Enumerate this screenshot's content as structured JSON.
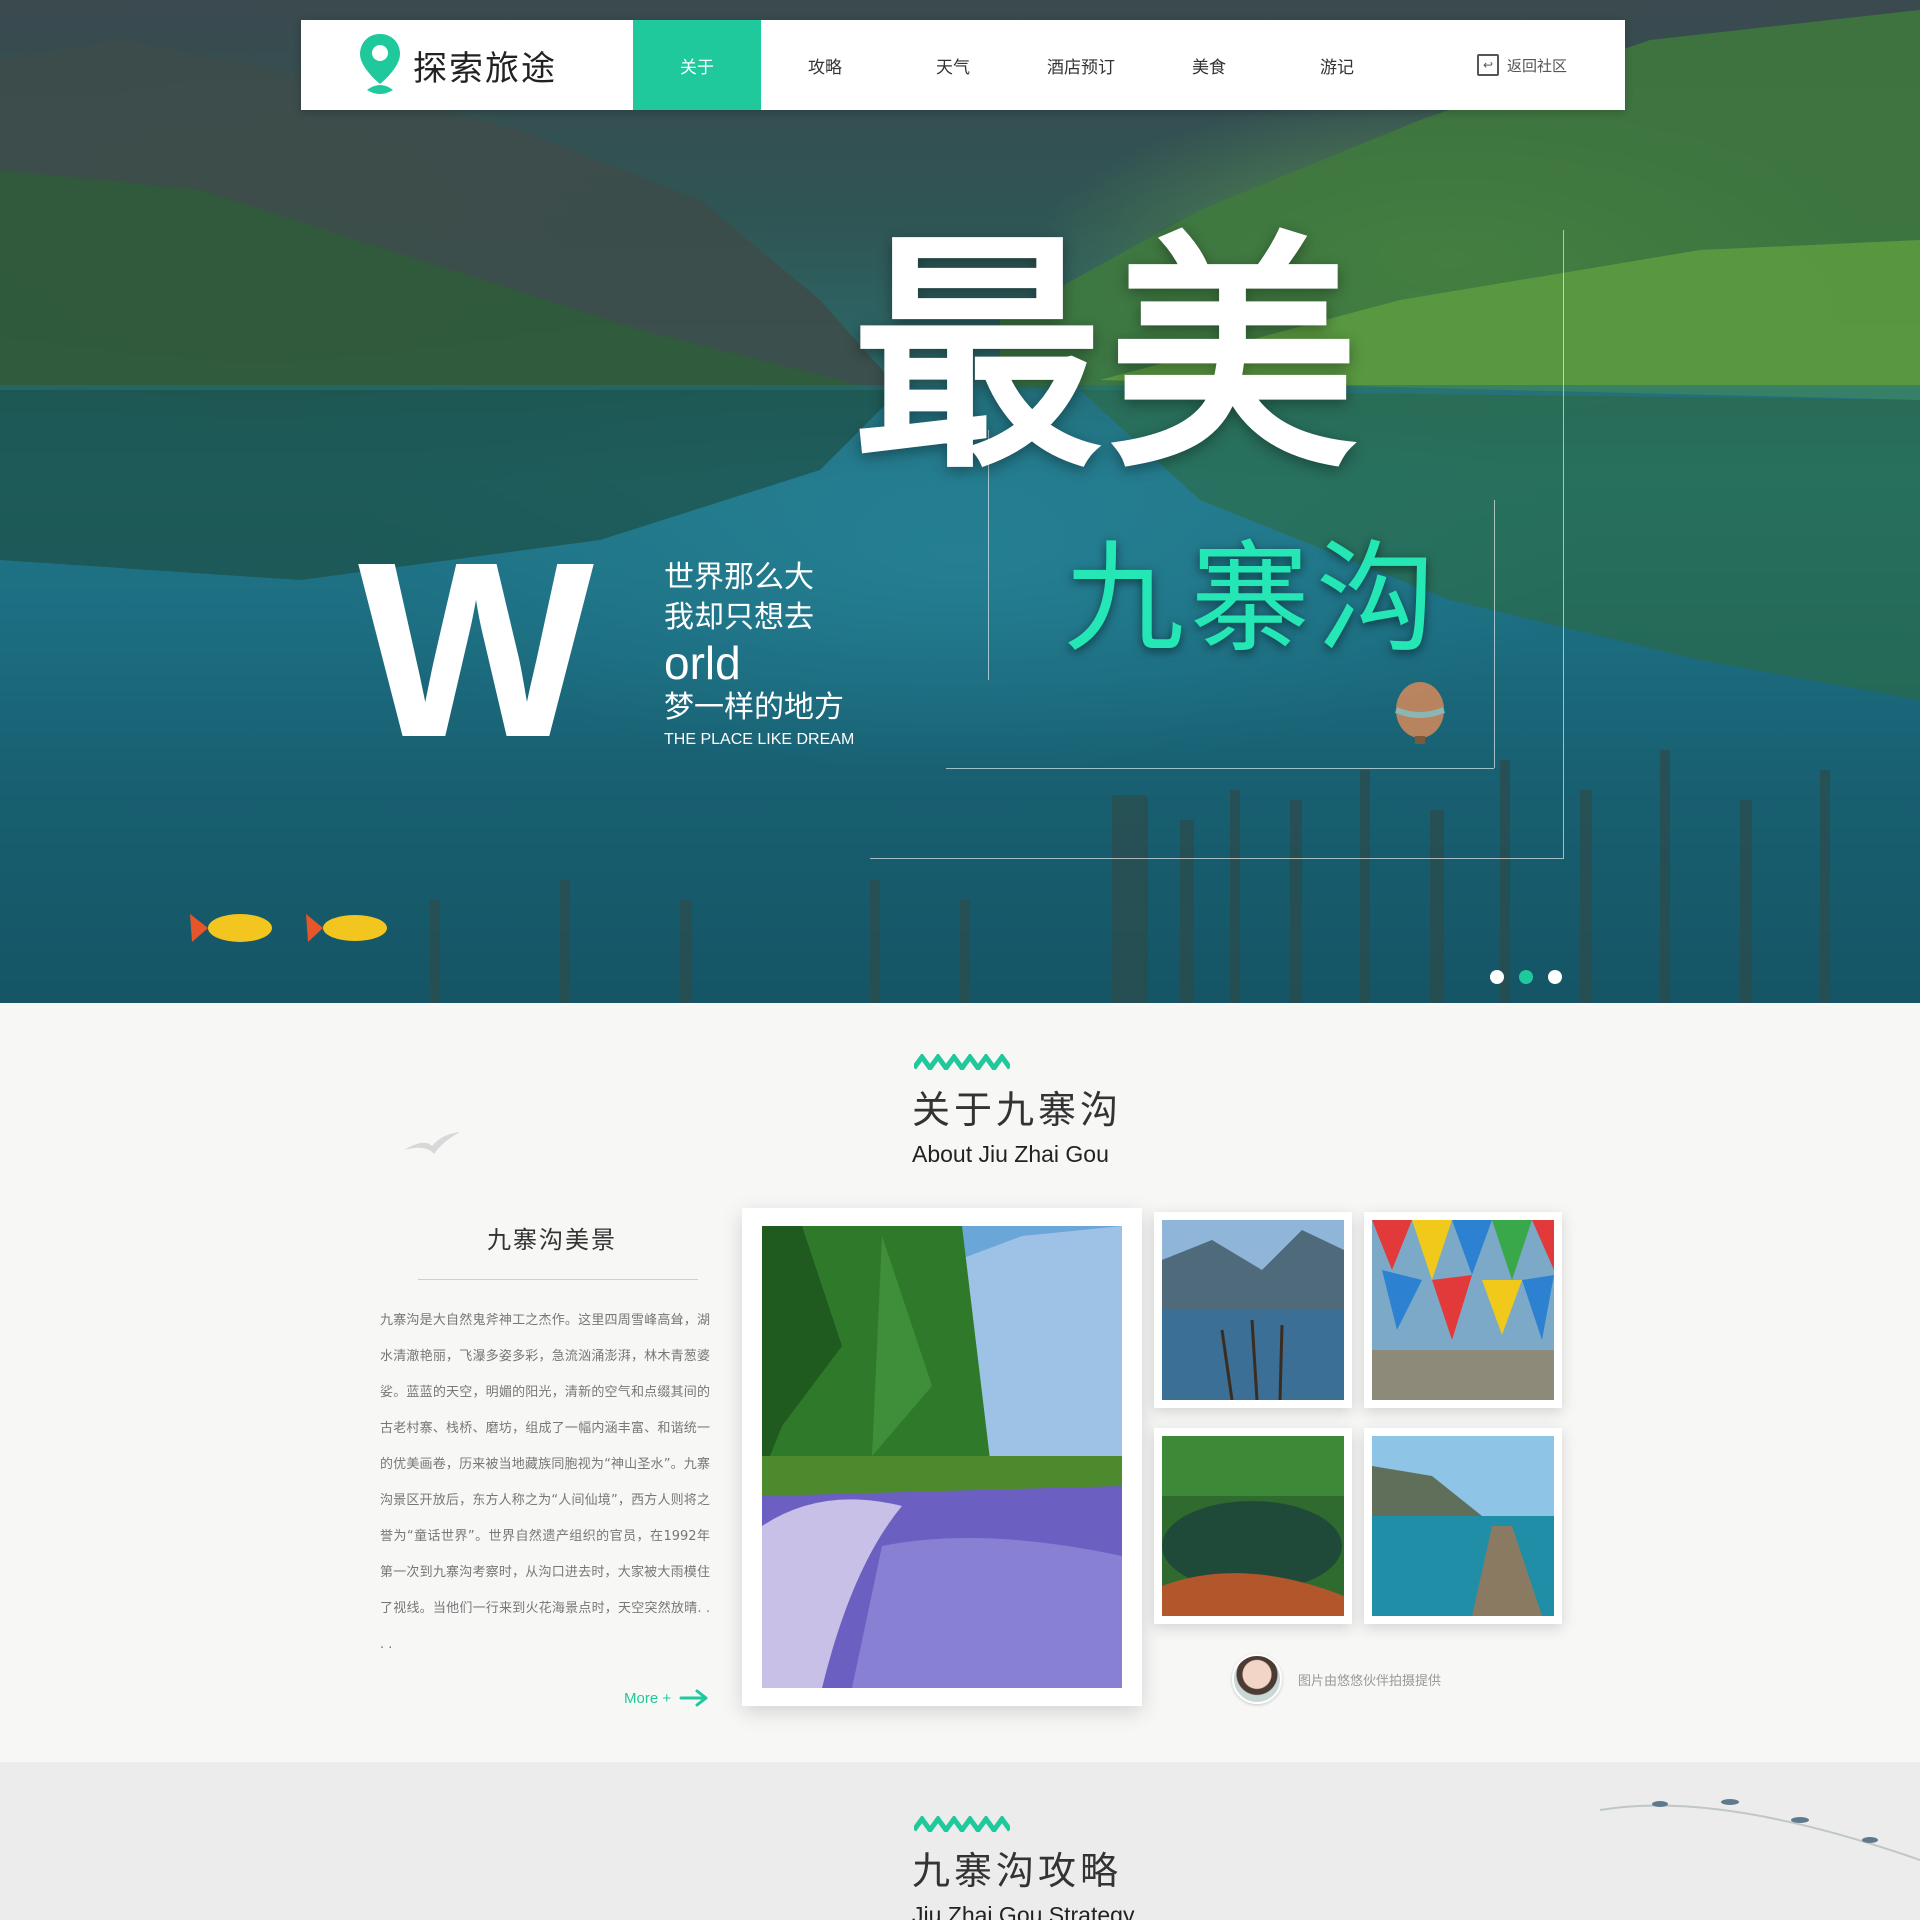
{
  "brand": {
    "name": "探索旅途",
    "accent": "#1fc99b"
  },
  "nav": {
    "items": [
      {
        "label": "关于",
        "active": true
      },
      {
        "label": "攻略",
        "active": false
      },
      {
        "label": "天气",
        "active": false
      },
      {
        "label": "酒店预订",
        "active": false
      },
      {
        "label": "美食",
        "active": false
      },
      {
        "label": "游记",
        "active": false
      }
    ],
    "back_label": "返回社区",
    "back_icon": "return-icon"
  },
  "hero": {
    "headline": "最美",
    "subheadline": "九寨沟",
    "big_letter": "W",
    "slogan": {
      "line1": "世界那么大",
      "line2": "我却只想去",
      "line3": "orld",
      "line4": "梦一样的地方",
      "line5": "THE PLACE LIKE DREAM"
    },
    "carousel": {
      "count": 3,
      "active_index": 1
    }
  },
  "about": {
    "title_cn": "关于九寨沟",
    "title_en": "About Jiu Zhai Gou",
    "side_title": "九寨沟美景",
    "description": "九寨沟是大自然鬼斧神工之杰作。这里四周雪峰高耸，湖水清澈艳丽，飞瀑多姿多彩，急流汹涌澎湃，林木青葱婆娑。蓝蓝的天空，明媚的阳光，清新的空气和点缀其间的古老村寨、栈桥、磨坊，组成了一幅内涵丰富、和谐统一的优美画卷，历来被当地藏族同胞视为“神山圣水”。九寨沟景区开放后，东方人称之为“人间仙境”，西方人则将之誉为“童话世界”。世界自然遗产组织的官员，在1992年第一次到九寨沟考察时，从沟口进去时，大家被大雨模住了视线。当他们一行来到火花海景点时，天空突然放晴. . . .",
    "more_label": "More +",
    "credit": "图片由悠悠伙伴拍摄提供"
  },
  "strategy": {
    "title_cn": "九寨沟攻略",
    "title_en": "Jiu Zhai Gou Strategy"
  }
}
